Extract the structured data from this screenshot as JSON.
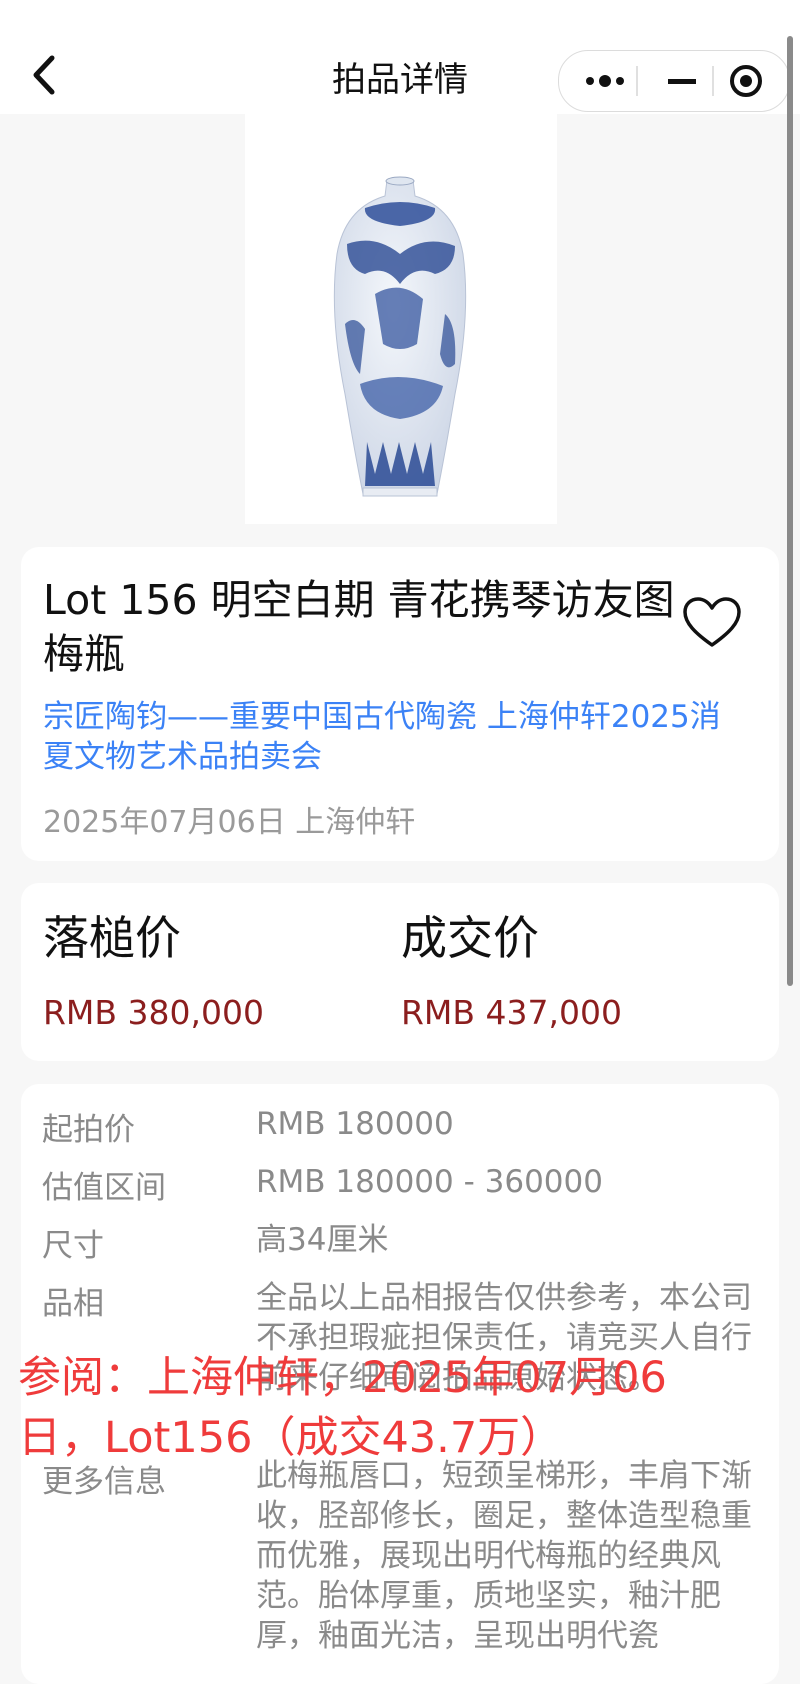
{
  "nav": {
    "title": "拍品详情"
  },
  "carousel": {
    "dot_count": 11,
    "active_index": 0
  },
  "lot": {
    "title": "Lot 156 明空白期 青花携琴访友图梅瓶",
    "auction_link": "宗匠陶钧——重要中国古代陶瓷 上海仲轩2025消夏文物艺术品拍卖会",
    "meta": "2025年07月06日 上海仲轩"
  },
  "prices": {
    "hammer_label": "落槌价",
    "hammer_value": "RMB 380,000",
    "final_label": "成交价",
    "final_value": "RMB 437,000"
  },
  "details": {
    "start_key": "起拍价",
    "start_val": "RMB 180000",
    "estimate_key": "估值区间",
    "estimate_val": "RMB 180000 - 360000",
    "size_key": "尺寸",
    "size_val": "高34厘米",
    "condition_key": "品相",
    "condition_val": "全品以上品相报告仅供参考，本公司不承担瑕疵担保责任，请竞买人自行前来仔细审阅拍品原始状态。",
    "more_key": "更多信息",
    "more_val": "此梅瓶唇口，短颈呈梯形，丰肩下渐收，胫部修长，圈足，整体造型稳重而优雅，展现出明代梅瓶的经典风范。胎体厚重，质地坚实，釉汁肥厚，釉面光洁，呈现出明代瓷"
  },
  "watermark": "参阅：上海仲轩，2025年07月06日，Lot156（成交43.7万）",
  "colors": {
    "accent": "#3b82f6",
    "price": "#8b1e1e",
    "watermark": "#ef3b3b"
  }
}
